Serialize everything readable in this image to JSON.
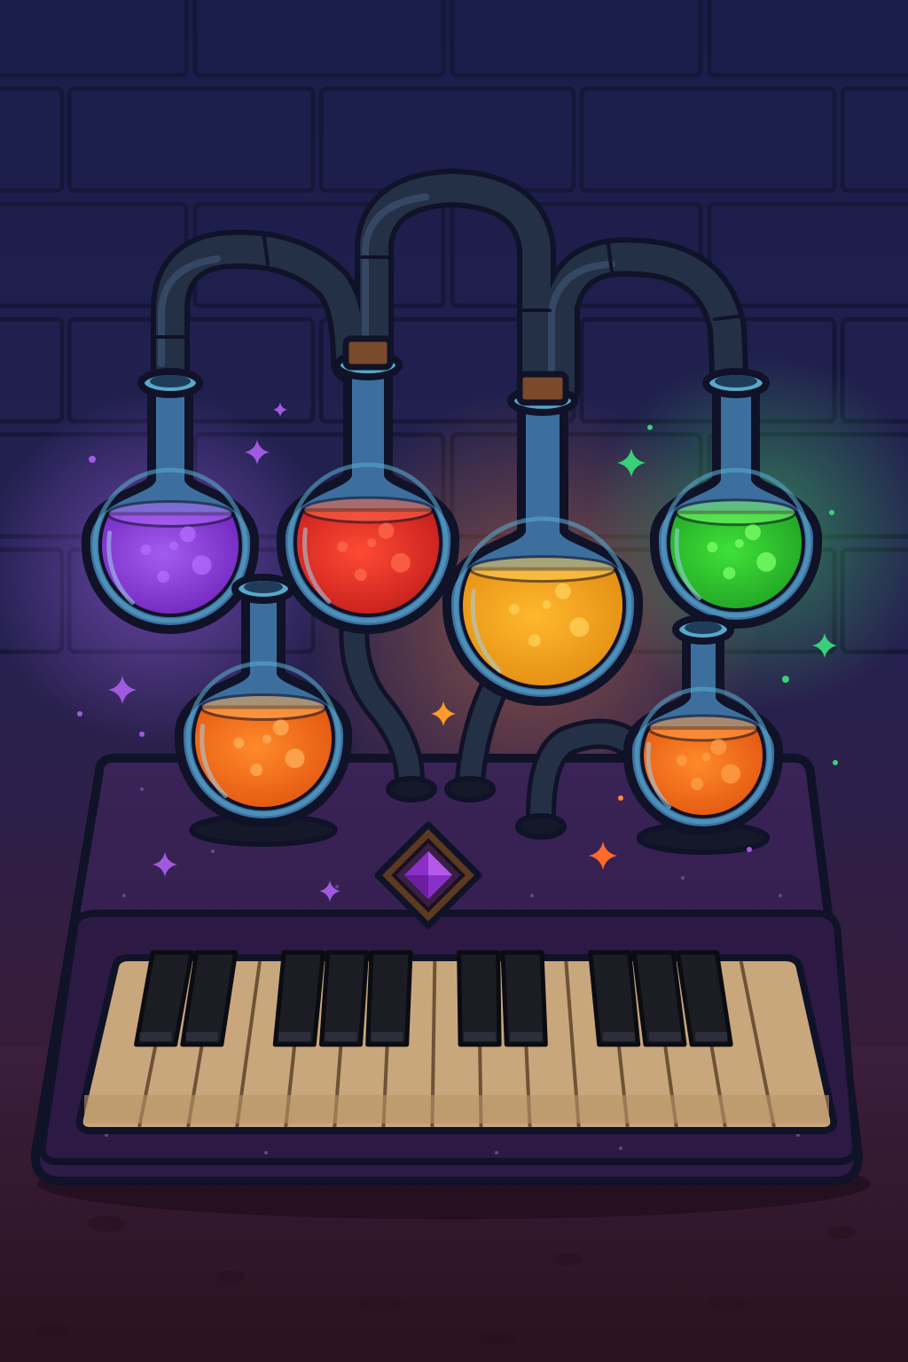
{
  "scene": {
    "subject": "potion-flask-organ",
    "colors": {
      "wall_top": "#1c1f4d",
      "wall_bottom": "#2a1f4a",
      "floor_top": "#3a1c3a",
      "floor_bottom": "#2b1320",
      "outline": "#101228",
      "tube": "#243045",
      "tube_highlight": "#3b4e6b",
      "glass": "#3d6f9e",
      "glass_rim": "#57a9c9",
      "cork": "#7a4a2b",
      "console": "#3b2456",
      "console_top": "#33214c",
      "console_trim": "#24163a",
      "gem": "#8a2fc9",
      "gem_frame": "#6b4a2a",
      "white_key": "#c9a77c",
      "white_key_shade": "#a98a63",
      "black_key": "#1c1c24"
    },
    "potions": [
      {
        "name": "purple-potion",
        "color": "#8b3fd6",
        "glow": "#b36bff"
      },
      {
        "name": "red-potion",
        "color": "#e8302a",
        "glow": "#ff6a4a"
      },
      {
        "name": "amber-potion",
        "color": "#f0a21e",
        "glow": "#ffd05a"
      },
      {
        "name": "green-potion",
        "color": "#2fc62f",
        "glow": "#7cff6a"
      },
      {
        "name": "orange-potion-left",
        "color": "#f0701e",
        "glow": "#ffb05a"
      },
      {
        "name": "orange-potion-right",
        "color": "#f06a1e",
        "glow": "#ffa04a"
      }
    ],
    "keyboard": {
      "white_keys": 15,
      "black_keys": 10
    },
    "sparkles": [
      {
        "name": "sparkle",
        "color": "#a05ae0"
      },
      {
        "name": "sparkle",
        "color": "#3ad07a"
      },
      {
        "name": "sparkle",
        "color": "#ff9b2a"
      },
      {
        "name": "sparkle",
        "color": "#ff6a2a"
      }
    ]
  }
}
